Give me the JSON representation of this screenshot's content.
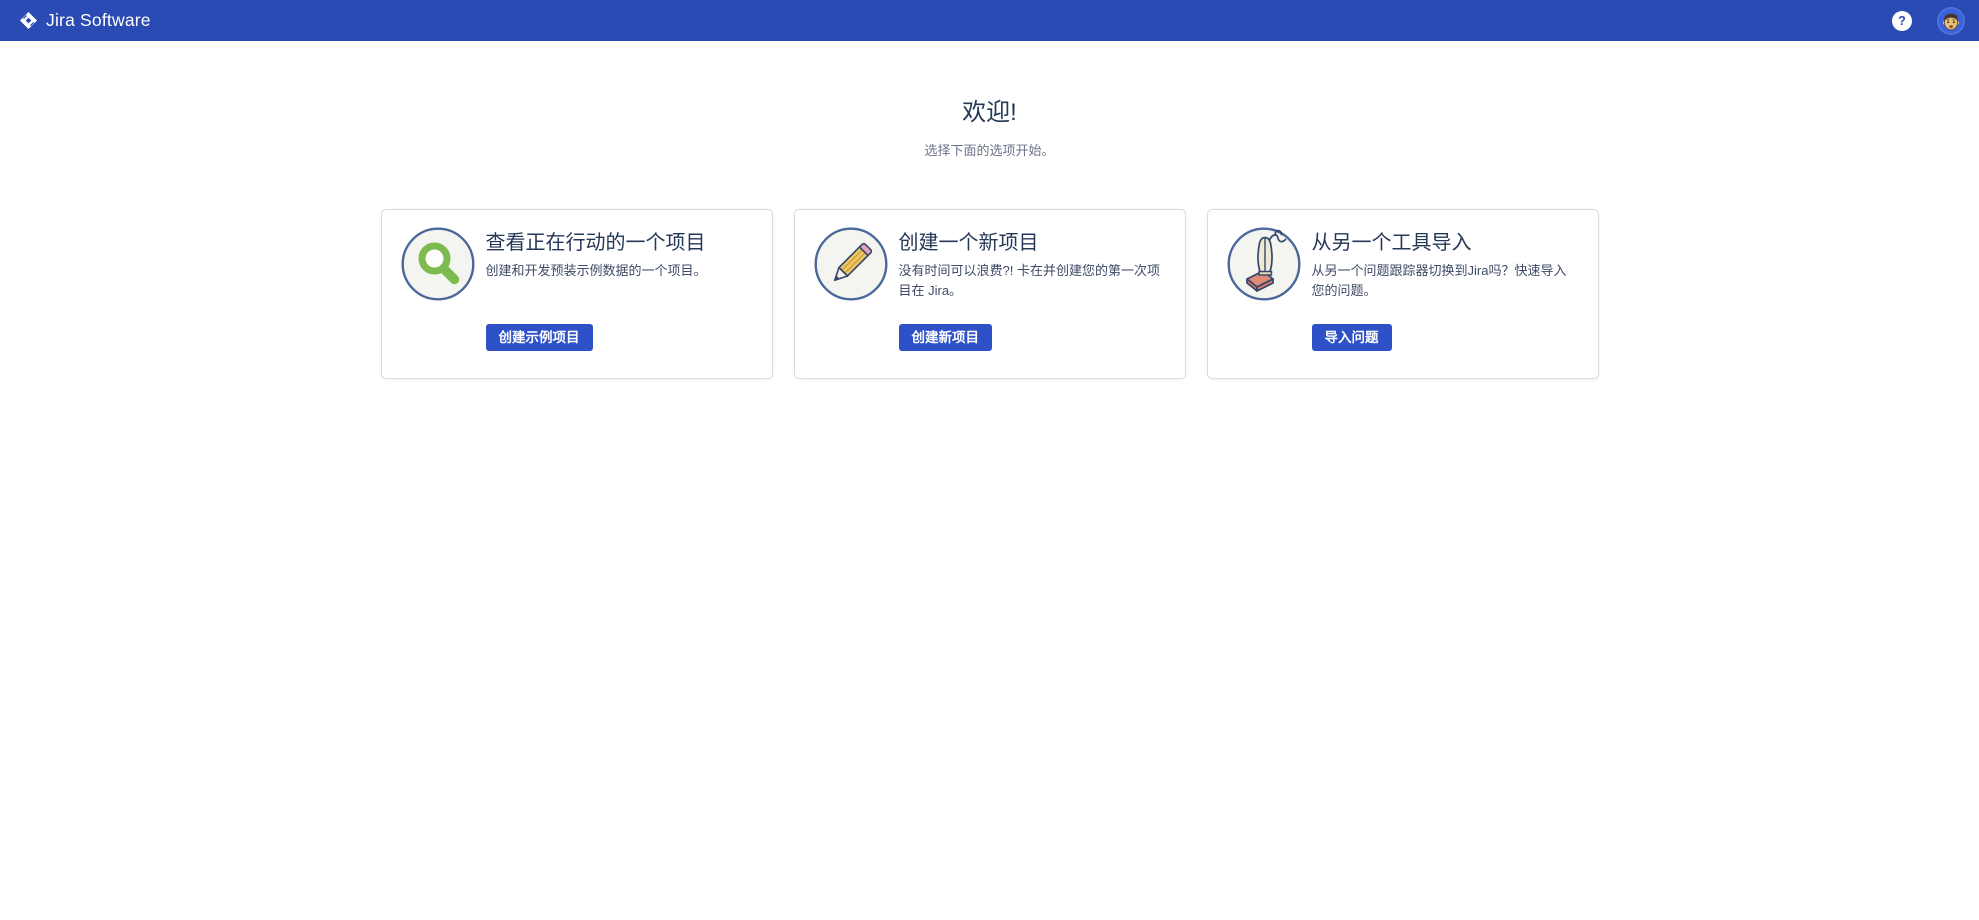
{
  "navbar": {
    "brand": "Jira Software",
    "help_tooltip": "?",
    "bg_color": "#2A4AB4"
  },
  "welcome": {
    "title": "欢迎!",
    "subtitle": "选择下面的选项开始。"
  },
  "cards": [
    {
      "icon": "magnifier-icon",
      "title": "查看正在行动的一个项目",
      "description": "创建和开发预装示例数据的一个项目。",
      "button": "创建示例项目"
    },
    {
      "icon": "pencil-icon",
      "title": "创建一个新项目",
      "description": "没有时间可以浪费?! 卡在并创建您的第一次项目在 Jira。",
      "button": "创建新项目"
    },
    {
      "icon": "vacuum-icon",
      "title": "从另一个工具导入",
      "description": "从另一个问题跟踪器切换到Jira吗？快速导入您的问题。",
      "button": "导入问题"
    }
  ],
  "colors": {
    "navbar_bg": "#2A4AB4",
    "button_bg": "#2E51C8",
    "icon_circle_border": "#4A6899",
    "magnifier_green": "#7EBB4F",
    "pencil_yellow": "#EFC763",
    "pencil_pink": "#E9A0BC",
    "vacuum_cream": "#EFE8D4",
    "vacuum_salmon": "#DE8B78",
    "title_text": "#253858",
    "subtitle_text": "#6E7387"
  }
}
